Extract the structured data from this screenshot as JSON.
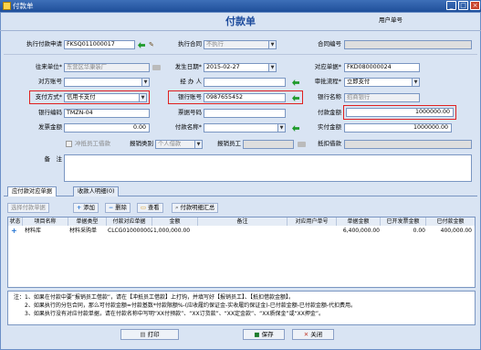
{
  "window": {
    "title": "付款单",
    "min": "_",
    "max": "□",
    "close": "×"
  },
  "form": {
    "title": "付款单",
    "doc_no_label": "用户单号"
  },
  "fields": {
    "exec_req": {
      "label": "执行付款申请",
      "value": "FKSQ011000017"
    },
    "exec_contract": {
      "label": "执行合同",
      "value": "不执行"
    },
    "contract_no": {
      "label": "合同编号",
      "value": ""
    },
    "partner": {
      "label": "往来单位*",
      "value": "东营区华康装厂"
    },
    "issue_date": {
      "label": "发生日期*",
      "value": "2015-02-27"
    },
    "doc_no": {
      "label": "对应单据*",
      "value": "FKD080000024"
    },
    "party_account": {
      "label": "对方账号",
      "value": ""
    },
    "handler": {
      "label": "经 办 人",
      "value": ""
    },
    "flow": {
      "label": "审批流程*",
      "value": "立即支付"
    },
    "pay_method": {
      "label": "支付方式*",
      "value": "信用卡支付"
    },
    "bank_account": {
      "label": "银行账号",
      "value": "0987655452"
    },
    "bank_name": {
      "label": "银行名称",
      "value": "招商银行"
    },
    "bank_code": {
      "label": "银行编码",
      "value": "TMZN-04"
    },
    "ticket_code": {
      "label": "票据号码",
      "value": ""
    },
    "pay_amount": {
      "label": "付款金额",
      "value": "1000000.00"
    },
    "invoice_amount": {
      "label": "发票金额",
      "value": "0.00"
    },
    "pay_name": {
      "label": "付款名称*",
      "value": ""
    },
    "actual_amount": {
      "label": "实付金额",
      "value": "1000000.00"
    },
    "borrow_check": {
      "label": "冲抵员工借款"
    },
    "borrow_type": {
      "label": "报销类别",
      "value": "个人借款"
    },
    "borrow_employee": {
      "label": "报销员工",
      "value": ""
    },
    "offset_amount": {
      "label": "抵扣借款",
      "value": ""
    },
    "remark": {
      "label": "备　注",
      "value": ""
    }
  },
  "tabs": [
    "应付款对应单据",
    "收款人明细(0)"
  ],
  "toolbar": {
    "select": "选择付款单据",
    "add": "添加",
    "delete": "删除",
    "view": "查看",
    "summary": "付款明细汇总"
  },
  "table": {
    "headers": [
      "状态",
      "项目名称",
      "单据类型",
      "付款对应单据",
      "金额",
      "备注",
      "对应用户单号",
      "单据金额",
      "已开发票金额",
      "已付款金额"
    ],
    "rows": [
      [
        "",
        "材料库",
        "材料采购单",
        "CLCG0100000020",
        "1,000,000.00",
        "",
        "",
        "6,400,000.00",
        "0.00",
        "400,000.00"
      ]
    ]
  },
  "notes": [
    "注：1、如果在付款中要“报销员工借款”，请在【冲抵员工借款】上打钩，并填写好【报销员工】、【抵扣借款金额】。",
    "2、如果执行的分包合同，那么可付款金额=付款基数*付款限额%-(应收履约保证金-实收履约保证金)-已付款金额-已付款金额-代扣费用。",
    "3、如果执行没有对应付款单据，请在付款名称中写明“XX付预款”、“XX订货款”、“XX定金款”、“XX质保金”或“XX押金”。"
  ],
  "buttons": {
    "print": "打印",
    "save": "保存",
    "close": "关闭"
  }
}
